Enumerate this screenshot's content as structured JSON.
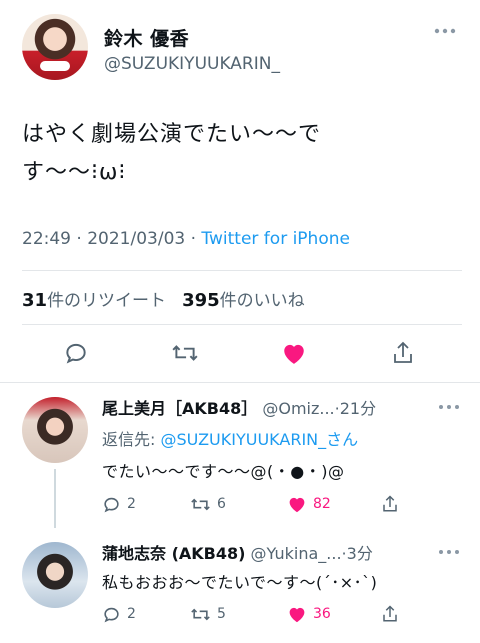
{
  "main_tweet": {
    "author_name": "鈴木 優香",
    "author_handle": "@SUZUKIYUUKARIN_",
    "text": "はやく劇場公演でたい〜〜で\nす〜〜⁝ω⁝",
    "time": "22:49",
    "date": "2021/03/03",
    "separator": "·",
    "source": "Twitter for iPhone",
    "retweets_count": "31",
    "retweets_label": "件のリツイート",
    "likes_count": "395",
    "likes_label": "件のいいね"
  },
  "replies": [
    {
      "name": "尾上美月［AKB48］",
      "handle": "@Omiz...",
      "time": "·21分",
      "replying_label": "返信先:",
      "replying_to": "@SUZUKIYUUKARIN_さん",
      "text": "でたい〜〜です〜〜@(・●・)@",
      "reply_count": "2",
      "retweet_count": "6",
      "like_count": "82"
    },
    {
      "name": "蒲地志奈 (AKB48)",
      "handle": "@Yukina_...",
      "time": "·3分",
      "text": "私もおおお〜でたいで〜す〜(´･×･`)",
      "reply_count": "2",
      "retweet_count": "5",
      "like_count": "36"
    }
  ],
  "colors": {
    "link": "#1d9bf0",
    "like": "#f91880",
    "muted": "#536471"
  }
}
